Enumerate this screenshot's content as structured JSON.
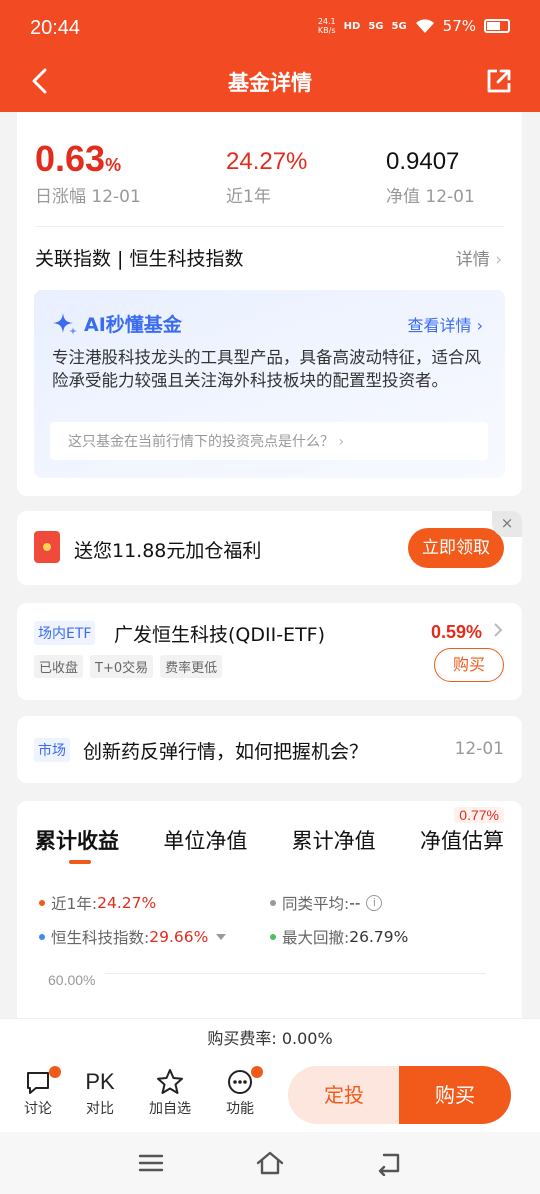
{
  "status": {
    "time": "20:44",
    "net_speed_top": "24.1",
    "net_speed_unit": "KB/s",
    "hd": "HD",
    "sig1": "5G",
    "sig2": "5G",
    "battery": "57%"
  },
  "nav": {
    "title": "基金详情"
  },
  "perf": {
    "daily_change_value": "0.63",
    "daily_change_unit": "%",
    "daily_change_label": "日涨幅 12-01",
    "year_return": "24.27%",
    "year_label": "近1年",
    "nav_value": "0.9407",
    "nav_label": "净值 12-01",
    "index_label": "关联指数 | 恒生科技指数",
    "index_more": "详情"
  },
  "ai": {
    "title": "AI秒懂基金",
    "more": "查看详情",
    "body": "专注港股科技龙头的工具型产品，具备高波动特征，适合风险承受能力较强且关注海外科技板块的配置型投资者。",
    "question": "这只基金在当前行情下的投资亮点是什么？"
  },
  "promo": {
    "text": "送您11.88元加仓福利",
    "button": "立即领取",
    "close": "×"
  },
  "etf": {
    "tag": "场内ETF",
    "name": "广发恒生科技(QDII-ETF)",
    "change": "0.59%",
    "chips": [
      "已收盘",
      "T+0交易",
      "费率更低"
    ],
    "buy": "购买"
  },
  "news": {
    "tag": "市场",
    "text": "创新药反弹行情，如何把握机会？",
    "date": "12-01"
  },
  "chart_section": {
    "badge": "0.77%",
    "tabs": [
      "累计收益",
      "单位净值",
      "累计净值",
      "净值估算"
    ],
    "legend": {
      "year_label": "近1年:",
      "year_value": "24.27%",
      "peer_label": "同类平均:",
      "peer_value": "--",
      "index_label": "恒生科技指数:",
      "index_value": "29.66%",
      "drawdown_label": "最大回撤:",
      "drawdown_value": "26.79%"
    },
    "y_tick": "60.00%",
    "colors": {
      "fund": "#f25a1c",
      "peer": "#999999",
      "index": "#3a8cf0",
      "drawdown": "#4cc15a"
    }
  },
  "fee": {
    "text": "购买费率: 0.00%"
  },
  "actions": {
    "discuss": "讨论",
    "compare_icon": "PK",
    "compare": "对比",
    "watch": "加自选",
    "more": "功能",
    "fixed": "定投",
    "buy": "购买"
  },
  "colors": {
    "brand": "#f24a22",
    "accent": "#f25a1c",
    "up": "#e32b1e",
    "ai": "#3a6cf0"
  }
}
